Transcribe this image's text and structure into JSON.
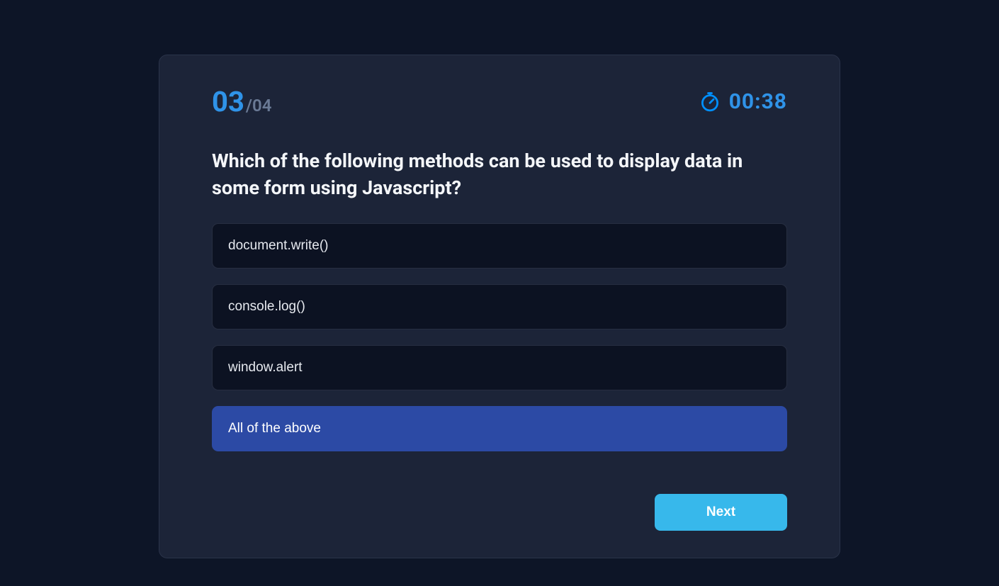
{
  "progress": {
    "current": "03",
    "total": "/04"
  },
  "timer": {
    "value": "00:38"
  },
  "question": "Which of the following methods can be used to display data in some form using Javascript?",
  "options": [
    {
      "label": "document.write()",
      "selected": false
    },
    {
      "label": "console.log()",
      "selected": false
    },
    {
      "label": "window.alert",
      "selected": false
    },
    {
      "label": "All of the above",
      "selected": true
    }
  ],
  "nextButton": "Next"
}
